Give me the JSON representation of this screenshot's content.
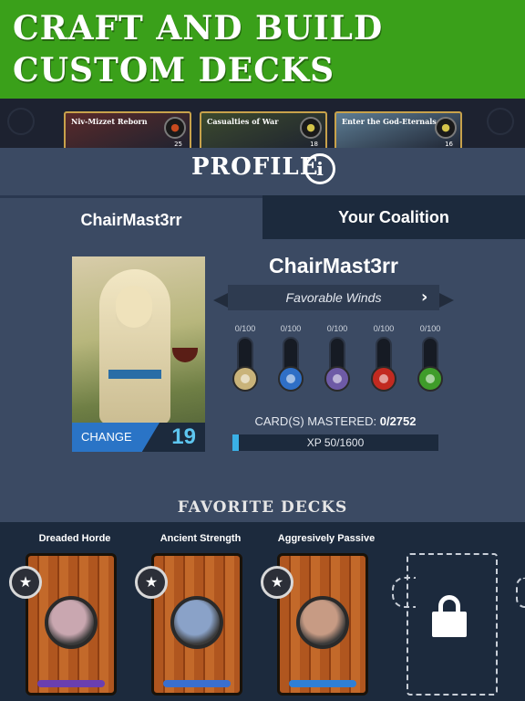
{
  "banner": {
    "title": "CRAFT AND BUILD\nCUSTOM DECKS"
  },
  "strip": {
    "cards": [
      {
        "name": "Niv-Mizzet Reborn",
        "count": "25",
        "color": "#c84a1e",
        "art": "#5a2a2a"
      },
      {
        "name": "Casualties of War",
        "count": "18",
        "color": "#d4c44a",
        "art": "#3c4a2e"
      },
      {
        "name": "Enter the God-Eternals",
        "count": "16",
        "color": "#d4c44a",
        "art": "#5d7d94"
      }
    ]
  },
  "profile": {
    "title": "PROFILE",
    "info_icon": "i"
  },
  "tabs": {
    "active": "ChairMast3rr",
    "inactive": "Your Coalition"
  },
  "player": {
    "name": "ChairMast3rr",
    "title": "Favorable Winds",
    "level": "19",
    "change_label": "CHANGE"
  },
  "mana_meters": [
    {
      "label": "0/100",
      "icon": "white-mana-icon",
      "color": "#c9b37a",
      "fill": 0
    },
    {
      "label": "0/100",
      "icon": "blue-mana-icon",
      "color": "#2f6fc6",
      "fill": 0
    },
    {
      "label": "0/100",
      "icon": "black-mana-icon",
      "color": "#6e5aa6",
      "fill": 0
    },
    {
      "label": "0/100",
      "icon": "red-mana-icon",
      "color": "#c22a20",
      "fill": 0
    },
    {
      "label": "0/100",
      "icon": "green-mana-icon",
      "color": "#3f9c2a",
      "fill": 0
    }
  ],
  "mastery": {
    "label": "CARD(S) MASTERED:",
    "value": "0/2752"
  },
  "xp": {
    "label": "XP 50/1600",
    "fraction": 0.03125
  },
  "favorite_decks": {
    "title": "FAVORITE DECKS",
    "decks": [
      {
        "name": "Dreaded Horde",
        "bar_color": "#6a3fb0",
        "avatar": "#c9a7b0"
      },
      {
        "name": "Ancient Strength",
        "bar_color": "#3a6fcf",
        "avatar": "#8aa2c8"
      },
      {
        "name": "Aggresively Passive",
        "bar_color": "#2f7fd6",
        "avatar": "#c79b84"
      }
    ]
  }
}
